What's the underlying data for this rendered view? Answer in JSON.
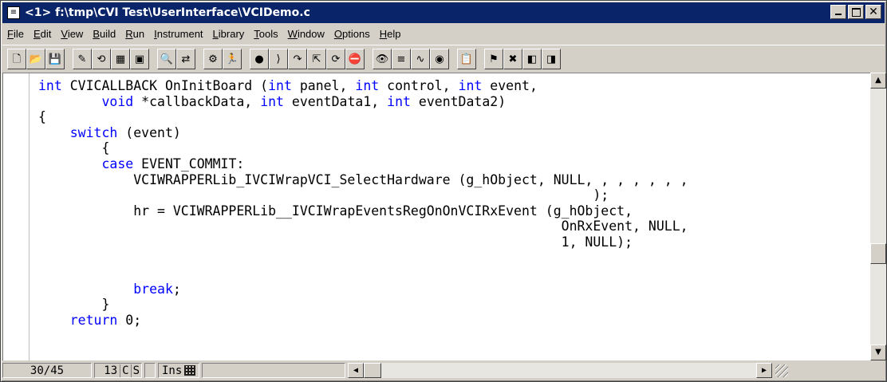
{
  "window": {
    "title": "<1> f:\\tmp\\CVI Test\\UserInterface\\VCIDemo.c",
    "system_icon": "document-icon",
    "minimize_glyph": "_",
    "maximize_glyph": "□",
    "close_glyph": "✕"
  },
  "menu": [
    {
      "pre": "",
      "u": "F",
      "post": "ile"
    },
    {
      "pre": "",
      "u": "E",
      "post": "dit"
    },
    {
      "pre": "",
      "u": "V",
      "post": "iew"
    },
    {
      "pre": "",
      "u": "B",
      "post": "uild"
    },
    {
      "pre": "",
      "u": "R",
      "post": "un"
    },
    {
      "pre": "",
      "u": "I",
      "post": "nstrument"
    },
    {
      "pre": "",
      "u": "L",
      "post": "ibrary"
    },
    {
      "pre": "",
      "u": "T",
      "post": "ools"
    },
    {
      "pre": "",
      "u": "W",
      "post": "indow"
    },
    {
      "pre": "",
      "u": "O",
      "post": "ptions"
    },
    {
      "pre": "",
      "u": "H",
      "post": "elp"
    }
  ],
  "toolbar_groups": [
    [
      {
        "name": "new-file-icon",
        "glyph": "🗋"
      },
      {
        "name": "open-file-icon",
        "glyph": "📂"
      },
      {
        "name": "save-icon",
        "glyph": "💾"
      }
    ],
    [
      {
        "name": "edit-uir-icon",
        "glyph": "✎"
      },
      {
        "name": "recall-panel-icon",
        "glyph": "⟲"
      },
      {
        "name": "function-panel-icon",
        "glyph": "▦"
      },
      {
        "name": "window-icon",
        "glyph": "▣"
      }
    ],
    [
      {
        "name": "find-icon",
        "glyph": "🔍"
      },
      {
        "name": "find-replace-icon",
        "glyph": "⇄"
      }
    ],
    [
      {
        "name": "build-icon",
        "glyph": "⚙"
      },
      {
        "name": "run-icon",
        "glyph": "🏃"
      }
    ],
    [
      {
        "name": "go-icon",
        "glyph": "●"
      },
      {
        "name": "step-into-icon",
        "glyph": "⟩"
      },
      {
        "name": "step-over-icon",
        "glyph": "↷"
      },
      {
        "name": "step-out-icon",
        "glyph": "⇱"
      },
      {
        "name": "continue-icon",
        "glyph": "⟳"
      },
      {
        "name": "stop-icon",
        "glyph": "⛔"
      }
    ],
    [
      {
        "name": "watch-icon",
        "glyph": "👁"
      },
      {
        "name": "variables-icon",
        "glyph": "≡"
      },
      {
        "name": "memory-icon",
        "glyph": "∿"
      },
      {
        "name": "breakpoints-icon",
        "glyph": "◉"
      }
    ],
    [
      {
        "name": "clipboard-icon",
        "glyph": "📋"
      }
    ],
    [
      {
        "name": "toggle-bookmark-icon",
        "glyph": "⚑"
      },
      {
        "name": "clear-bookmarks-icon",
        "glyph": "✖"
      },
      {
        "name": "prev-bookmark-icon",
        "glyph": "◧"
      },
      {
        "name": "next-bookmark-icon",
        "glyph": "◨"
      }
    ]
  ],
  "code": [
    [
      {
        "t": "int",
        "k": 1
      },
      {
        "t": " CVICALLBACK OnInitBoard (",
        "k": 0
      },
      {
        "t": "int",
        "k": 1
      },
      {
        "t": " panel, ",
        "k": 0
      },
      {
        "t": "int",
        "k": 1
      },
      {
        "t": " control, ",
        "k": 0
      },
      {
        "t": "int",
        "k": 1
      },
      {
        "t": " event,",
        "k": 0
      }
    ],
    [
      {
        "t": "        ",
        "k": 0
      },
      {
        "t": "void",
        "k": 1
      },
      {
        "t": " *callbackData, ",
        "k": 0
      },
      {
        "t": "int",
        "k": 1
      },
      {
        "t": " eventData1, ",
        "k": 0
      },
      {
        "t": "int",
        "k": 1
      },
      {
        "t": " eventData2)",
        "k": 0
      }
    ],
    [
      {
        "t": "{",
        "k": 0
      }
    ],
    [
      {
        "t": "    ",
        "k": 0
      },
      {
        "t": "switch",
        "k": 1
      },
      {
        "t": " (event)",
        "k": 0
      }
    ],
    [
      {
        "t": "        {",
        "k": 0
      }
    ],
    [
      {
        "t": "        ",
        "k": 0
      },
      {
        "t": "case",
        "k": 1
      },
      {
        "t": " EVENT_COMMIT:",
        "k": 0
      }
    ],
    [
      {
        "t": "            VCIWRAPPERLib_IVCIWrapVCI_SelectHardware (g_hObject, NULL, , , , , , ,",
        "k": 0
      }
    ],
    [
      {
        "t": "                                                                      );",
        "k": 0
      }
    ],
    [
      {
        "t": "            hr = VCIWRAPPERLib__IVCIWrapEventsRegOnOnVCIRxEvent (g_hObject,",
        "k": 0
      }
    ],
    [
      {
        "t": "                                                                  OnRxEvent, NULL,",
        "k": 0
      }
    ],
    [
      {
        "t": "                                                                  1, NULL);",
        "k": 0
      }
    ],
    [
      {
        "t": "",
        "k": 0
      }
    ],
    [
      {
        "t": "",
        "k": 0
      }
    ],
    [
      {
        "t": "            ",
        "k": 0
      },
      {
        "t": "break",
        "k": 1
      },
      {
        "t": ";",
        "k": 0
      }
    ],
    [
      {
        "t": "        }",
        "k": 0
      }
    ],
    [
      {
        "t": "    ",
        "k": 0
      },
      {
        "t": "return",
        "k": 1
      },
      {
        "t": " 0;",
        "k": 0
      }
    ]
  ],
  "status": {
    "position": "30/45",
    "column": "13",
    "flag_c": "C",
    "flag_s": "S",
    "mode": "Ins"
  },
  "scroll": {
    "up": "▲",
    "down": "▼",
    "left": "◀",
    "right": "▶"
  },
  "colors": {
    "keyword": "#0000ff",
    "titlebar": "#0a246a",
    "chrome": "#d4d0c8"
  }
}
